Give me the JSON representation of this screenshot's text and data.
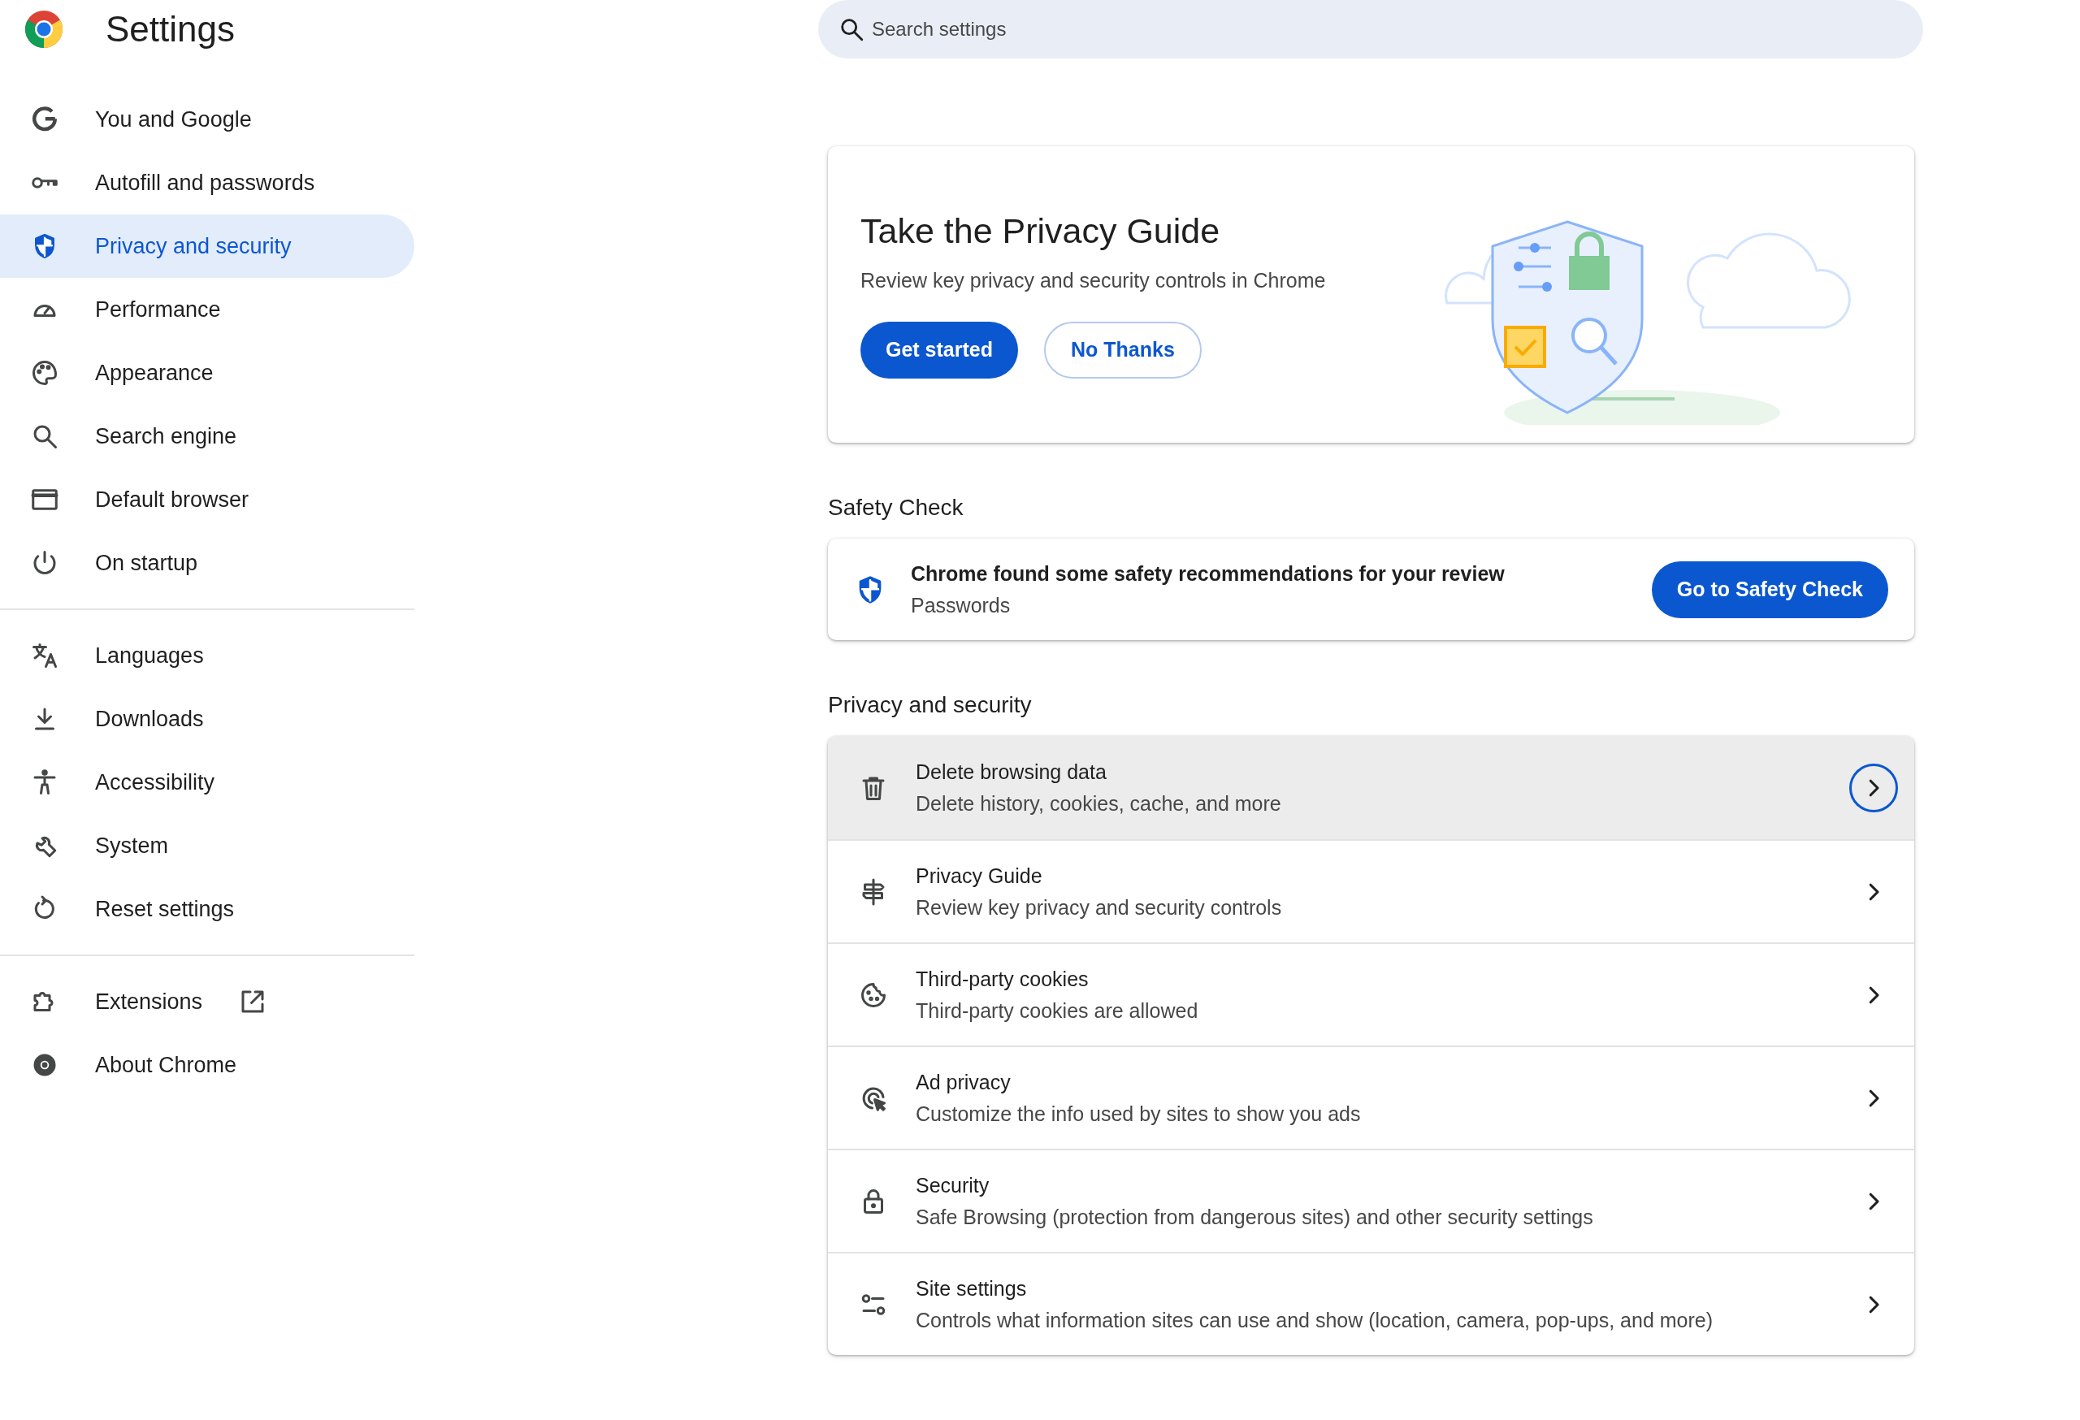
{
  "header": {
    "title": "Settings",
    "search": {
      "placeholder": "Search settings"
    }
  },
  "sidebar": {
    "groups": [
      {
        "items": [
          {
            "label": "You and Google",
            "selected": false,
            "external": false
          },
          {
            "label": "Autofill and passwords",
            "selected": false,
            "external": false
          },
          {
            "label": "Privacy and security",
            "selected": true,
            "external": false
          },
          {
            "label": "Performance",
            "selected": false,
            "external": false
          },
          {
            "label": "Appearance",
            "selected": false,
            "external": false
          },
          {
            "label": "Search engine",
            "selected": false,
            "external": false
          },
          {
            "label": "Default browser",
            "selected": false,
            "external": false
          },
          {
            "label": "On startup",
            "selected": false,
            "external": false
          }
        ]
      },
      {
        "items": [
          {
            "label": "Languages",
            "selected": false,
            "external": false
          },
          {
            "label": "Downloads",
            "selected": false,
            "external": false
          },
          {
            "label": "Accessibility",
            "selected": false,
            "external": false
          },
          {
            "label": "System",
            "selected": false,
            "external": false
          },
          {
            "label": "Reset settings",
            "selected": false,
            "external": false
          }
        ]
      },
      {
        "items": [
          {
            "label": "Extensions",
            "selected": false,
            "external": true
          },
          {
            "label": "About Chrome",
            "selected": false,
            "external": false
          }
        ]
      }
    ]
  },
  "privacy_guide_card": {
    "title": "Take the Privacy Guide",
    "description": "Review key privacy and security controls in Chrome",
    "buttons": [
      {
        "label": "Get started",
        "kind": "primary"
      },
      {
        "label": "No Thanks",
        "kind": "secondary"
      }
    ]
  },
  "safety_check": {
    "heading": "Safety Check",
    "message": "Chrome found some safety recommendations for your review",
    "detail": "Passwords",
    "button": "Go to Safety Check"
  },
  "privacy_section": {
    "heading": "Privacy and security",
    "rows": [
      {
        "title": "Delete browsing data",
        "subtitle": "Delete history, cookies, cache, and more",
        "highlighted": true
      },
      {
        "title": "Privacy Guide",
        "subtitle": "Review key privacy and security controls",
        "highlighted": false
      },
      {
        "title": "Third-party cookies",
        "subtitle": "Third-party cookies are allowed",
        "highlighted": false
      },
      {
        "title": "Ad privacy",
        "subtitle": "Customize the info used by sites to show you ads",
        "highlighted": false
      },
      {
        "title": "Security",
        "subtitle": "Safe Browsing (protection from dangerous sites) and other security settings",
        "highlighted": false
      },
      {
        "title": "Site settings",
        "subtitle": "Controls what information sites can use and show (location, camera, pop-ups, and more)",
        "highlighted": false
      }
    ]
  }
}
